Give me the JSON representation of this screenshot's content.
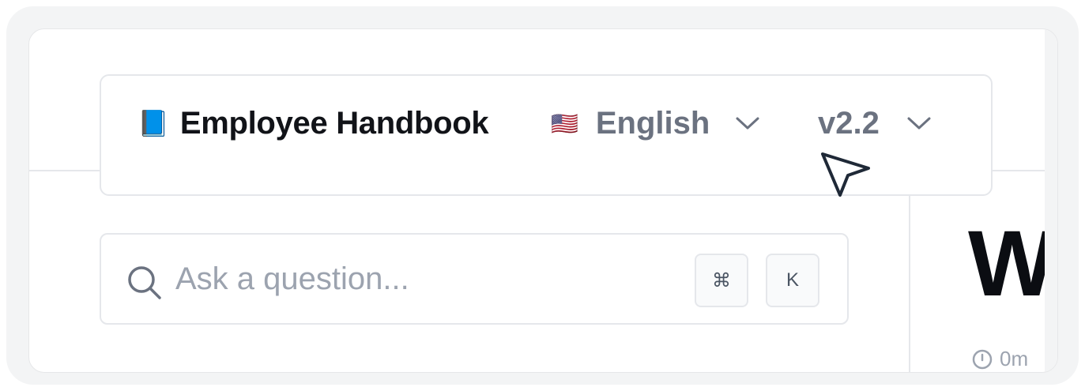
{
  "header": {
    "brand_icon": "blue-book-icon",
    "brand_emoji": "📘",
    "title": "Employee Handbook",
    "language": {
      "flag_icon": "us-flag-icon",
      "flag_emoji": "🇺🇸",
      "selected": "English"
    },
    "version": {
      "selected": "v2.2"
    }
  },
  "search": {
    "placeholder": "Ask a question...",
    "shortcut_keys": [
      "⌘",
      "K"
    ]
  },
  "content": {
    "heading_fragment": "W",
    "meta_fragment": "0m"
  },
  "colors": {
    "text_primary": "#111318",
    "text_muted": "#6b7280",
    "border": "#e5e7eb",
    "frame_bg": "#f3f4f5"
  }
}
